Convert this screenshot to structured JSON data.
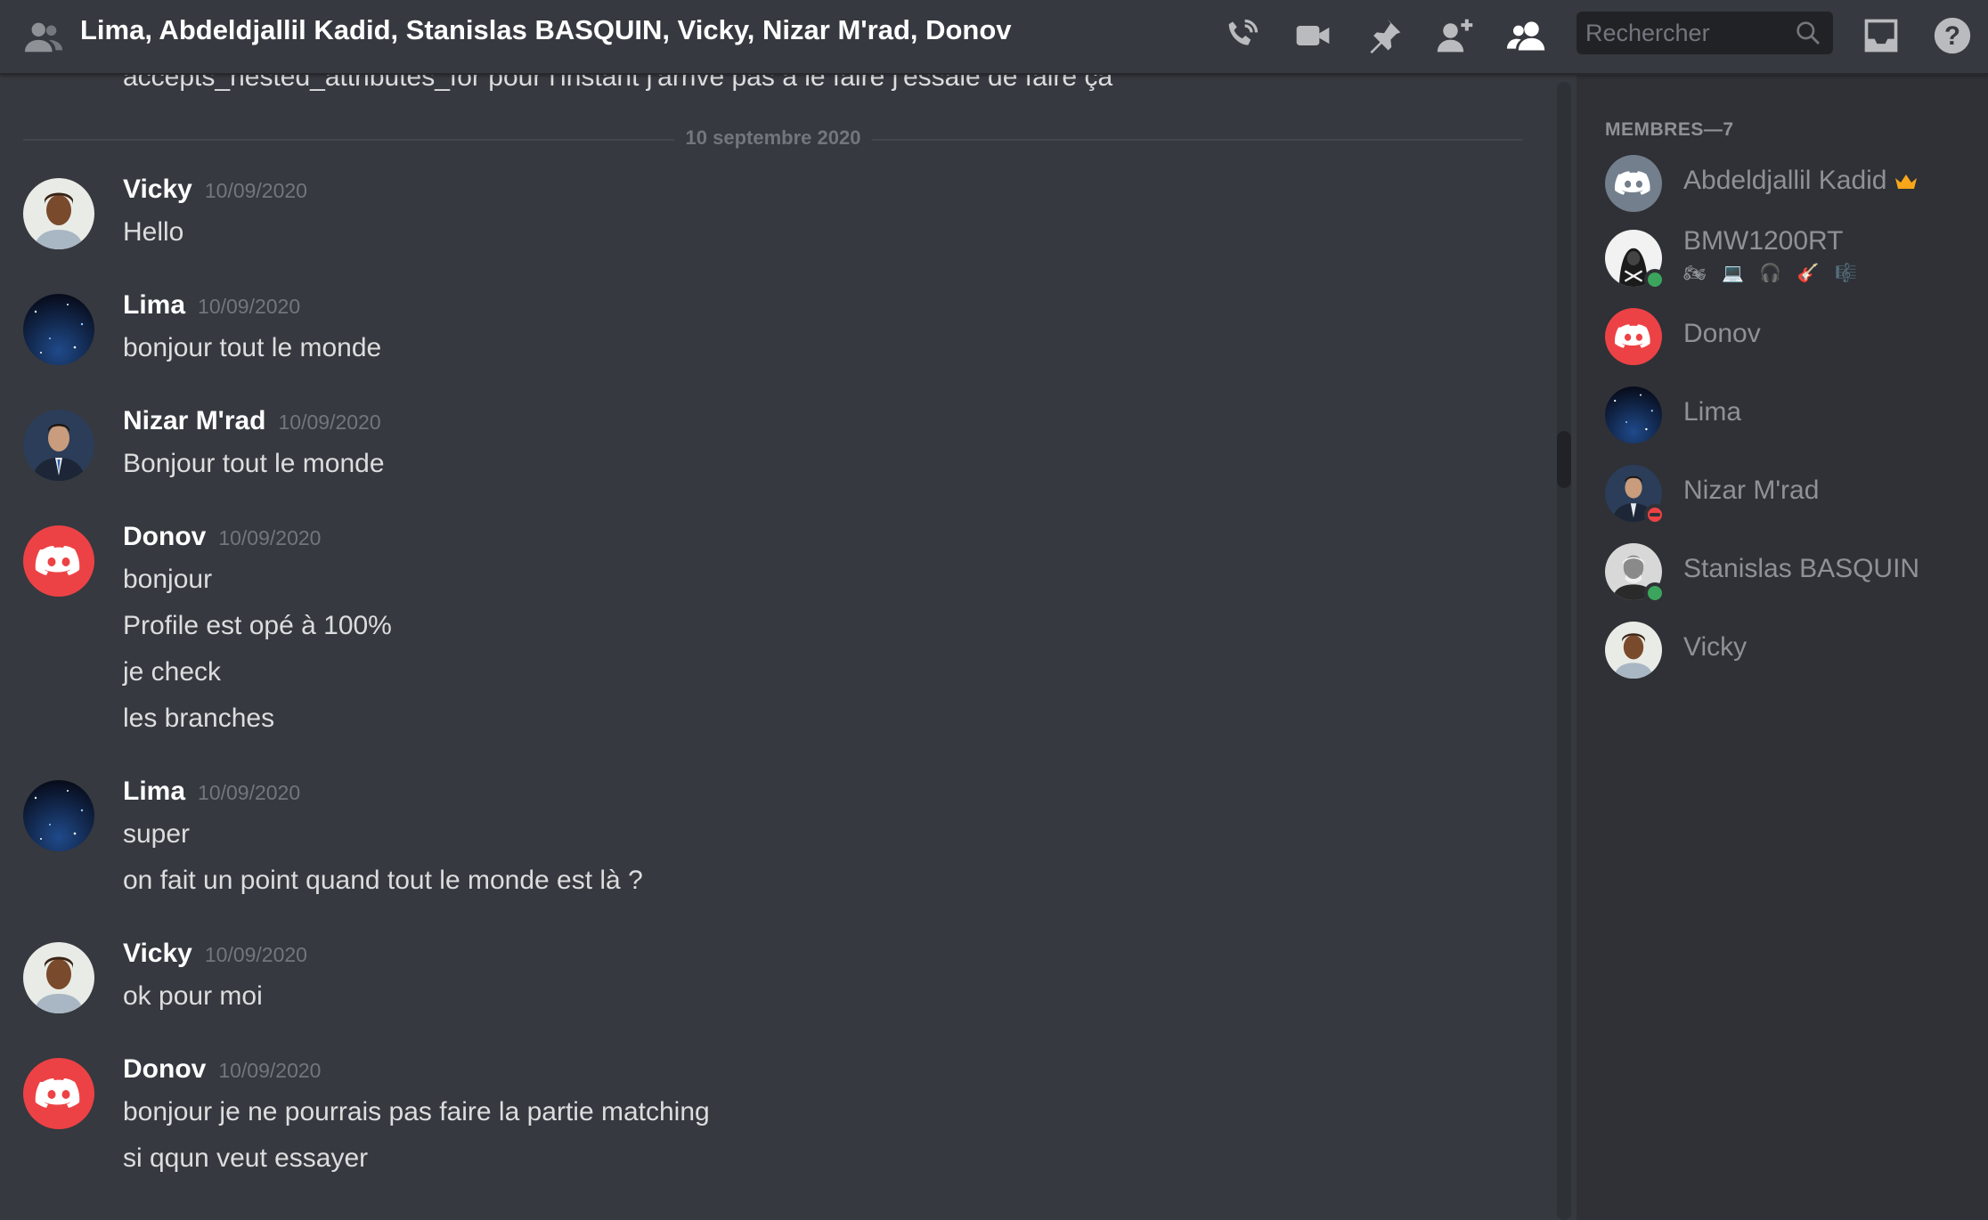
{
  "header": {
    "title": "Lima, Abdeldjallil Kadid, Stanislas BASQUIN, Vicky, Nizar M'rad, Donov",
    "search_placeholder": "Rechercher"
  },
  "chat": {
    "cutoff_text": "accepts_nested_attributes_for pour l'instant j'arrive pas à le faire j'essaie de faire ça",
    "date_divider": "10 septembre 2020",
    "messages": [
      {
        "author": "Vicky",
        "timestamp": "10/09/2020",
        "lines": [
          "Hello"
        ]
      },
      {
        "author": "Lima",
        "timestamp": "10/09/2020",
        "lines": [
          "bonjour tout le monde"
        ]
      },
      {
        "author": "Nizar M'rad",
        "timestamp": "10/09/2020",
        "lines": [
          "Bonjour tout le monde"
        ]
      },
      {
        "author": "Donov",
        "timestamp": "10/09/2020",
        "lines": [
          "bonjour",
          "Profile est opé à 100%",
          "je check",
          "les branches"
        ]
      },
      {
        "author": "Lima",
        "timestamp": "10/09/2020",
        "lines": [
          "super",
          "on fait un point quand tout le monde est là ?"
        ]
      },
      {
        "author": "Vicky",
        "timestamp": "10/09/2020",
        "lines": [
          "ok pour moi"
        ]
      },
      {
        "author": "Donov",
        "timestamp": "10/09/2020",
        "lines": [
          "bonjour je ne pourrais pas faire la partie matching",
          "si qqun veut essayer"
        ]
      }
    ]
  },
  "members": {
    "heading": "MEMBRES—7",
    "list": [
      {
        "name": "Abdeldjallil Kadid",
        "avatar": "discord-default-gray",
        "owner": true
      },
      {
        "name": "BMW1200RT",
        "avatar": "hooded-figure",
        "status": "online",
        "activity": "🏍 💻 🎧 🎸 🎼"
      },
      {
        "name": "Donov",
        "avatar": "discord-default-red"
      },
      {
        "name": "Lima",
        "avatar": "starfield"
      },
      {
        "name": "Nizar M'rad",
        "avatar": "suit-photo",
        "status": "dnd"
      },
      {
        "name": "Stanislas BASQUIN",
        "avatar": "bw-portrait",
        "status": "online"
      },
      {
        "name": "Vicky",
        "avatar": "woman-photo"
      }
    ]
  },
  "colors": {
    "background": "#36393f",
    "sidebar": "#2f3136",
    "discord_red": "#ed4245",
    "discord_gray": "#747f8d",
    "online": "#3ba55d",
    "dnd": "#ed4245",
    "crown": "#faa61a"
  }
}
